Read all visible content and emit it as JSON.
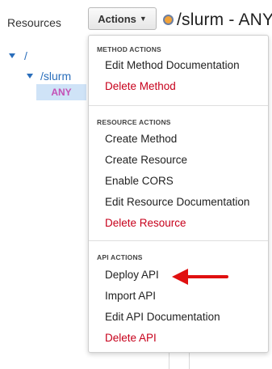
{
  "sidebar": {
    "title": "Resources",
    "tree": {
      "root": "/",
      "child": "/slurm",
      "method": "ANY"
    }
  },
  "toolbar": {
    "actions_label": "Actions"
  },
  "header": {
    "title": "/slurm - ANY"
  },
  "dropdown": {
    "method_actions": {
      "heading": "METHOD ACTIONS",
      "items": [
        "Edit Method Documentation",
        "Delete Method"
      ]
    },
    "resource_actions": {
      "heading": "RESOURCE ACTIONS",
      "items": [
        "Create Method",
        "Create Resource",
        "Enable CORS",
        "Edit Resource Documentation",
        "Delete Resource"
      ]
    },
    "api_actions": {
      "heading": "API ACTIONS",
      "items": [
        "Deploy API",
        "Import API",
        "Edit API Documentation",
        "Delete API"
      ]
    }
  },
  "colors": {
    "danger": "#c7001b",
    "link": "#2a6ebb",
    "method_badge": "#f2a33a",
    "annotation_arrow": "#e01010"
  }
}
